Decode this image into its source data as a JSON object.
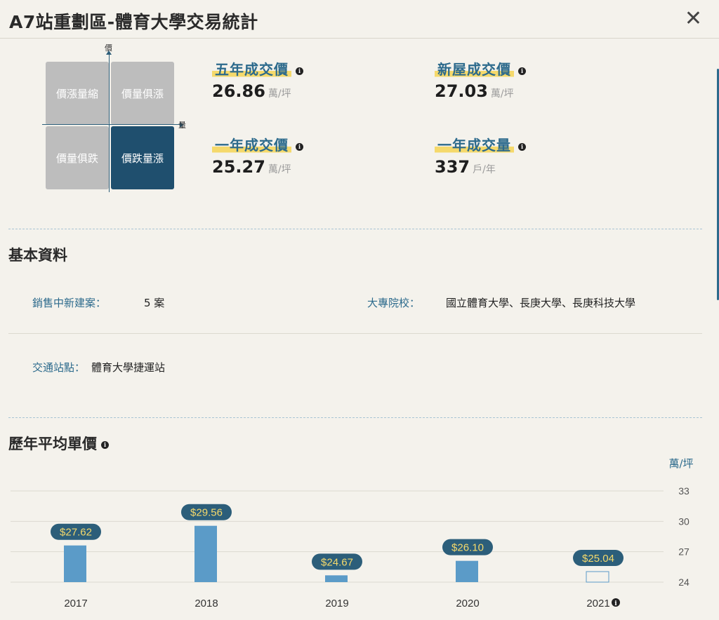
{
  "header": {
    "title": "A7站重劃區-體育大學交易統計",
    "close_label": "✕"
  },
  "quadrant": {
    "axis_price": "價",
    "axis_volume": "量",
    "cells": [
      {
        "label": "價漲量縮",
        "active": false
      },
      {
        "label": "價量俱漲",
        "active": false
      },
      {
        "label": "價量俱跌",
        "active": false
      },
      {
        "label": "價跌量漲",
        "active": true
      }
    ]
  },
  "stats": [
    {
      "label": "五年成交價",
      "value": "26.86",
      "unit": "萬/坪"
    },
    {
      "label": "新屋成交價",
      "value": "27.03",
      "unit": "萬/坪"
    },
    {
      "label": "一年成交價",
      "value": "25.27",
      "unit": "萬/坪"
    },
    {
      "label": "一年成交量",
      "value": "337",
      "unit": "戶/年"
    }
  ],
  "basic": {
    "title": "基本資料",
    "projects_label": "銷售中新建案：",
    "projects_value": "5 案",
    "schools_label": "大專院校：",
    "schools_value": "國立體育大學、長庚大學、長庚科技大學",
    "transit_label": "交通站點：",
    "transit_value": "體育大學捷運站"
  },
  "history": {
    "title": "歷年平均單價"
  },
  "colors": {
    "accent": "#2c6a8c",
    "highlight": "#f5d96b",
    "bar": "#5b9bc8",
    "bubble": "#2c5e7a",
    "bubble_text": "#f5d96b",
    "quadrant_active": "#1f4f6e"
  },
  "chart_data": {
    "type": "bar",
    "categories": [
      "2017",
      "2018",
      "2019",
      "2020",
      "2021"
    ],
    "values": [
      27.62,
      29.56,
      24.67,
      26.1,
      25.04
    ],
    "value_labels": [
      "$27.62",
      "$29.56",
      "$24.67",
      "$26.10",
      "$25.04"
    ],
    "ylabel": "萬/坪",
    "yticks": [
      33,
      30,
      27,
      24
    ],
    "ylim": [
      24,
      33
    ],
    "grid": true,
    "partial_categories": [
      "2021"
    ]
  }
}
